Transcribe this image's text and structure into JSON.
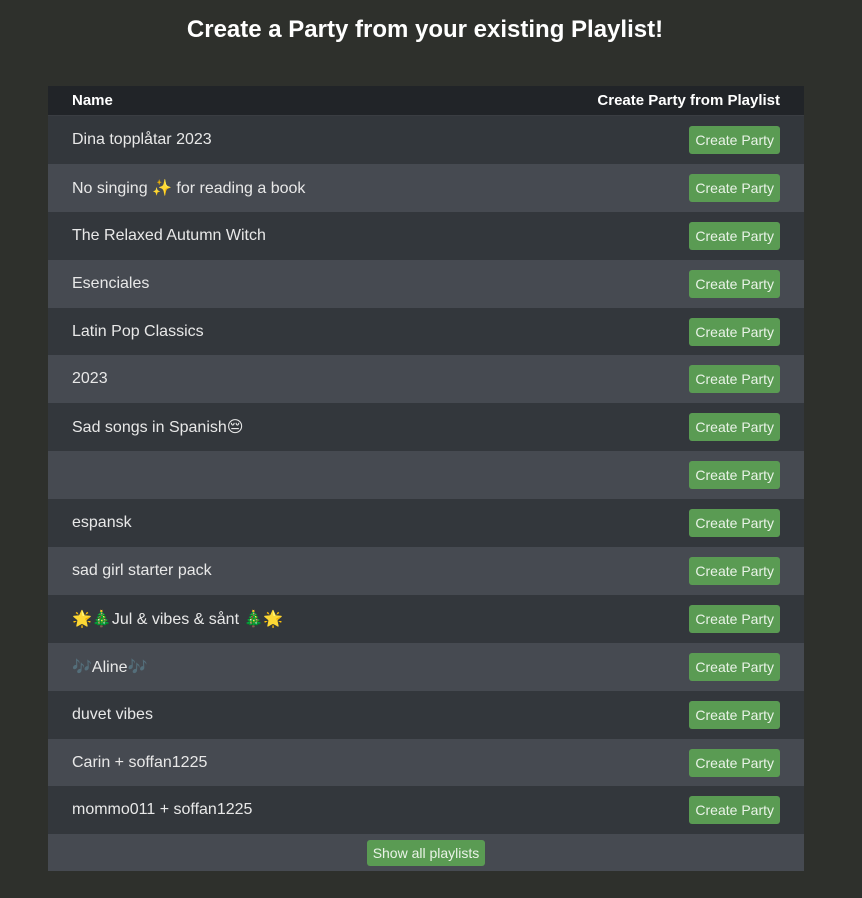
{
  "page": {
    "title": "Create a Party from your existing Playlist!"
  },
  "table": {
    "headers": {
      "name": "Name",
      "action": "Create Party from Playlist"
    },
    "rows": [
      {
        "name": "Dina topplåtar 2023",
        "button": "Create Party"
      },
      {
        "name": "No singing ✨ for reading a book",
        "button": "Create Party"
      },
      {
        "name": "The Relaxed Autumn Witch",
        "button": "Create Party"
      },
      {
        "name": "Esenciales",
        "button": "Create Party"
      },
      {
        "name": "Latin Pop Classics",
        "button": "Create Party"
      },
      {
        "name": "2023",
        "button": "Create Party"
      },
      {
        "name": "Sad songs in Spanish😔",
        "button": "Create Party"
      },
      {
        "name": "",
        "button": "Create Party"
      },
      {
        "name": "espansk",
        "button": "Create Party"
      },
      {
        "name": "sad girl starter pack",
        "button": "Create Party"
      },
      {
        "name": "🌟🎄Jul & vibes & sånt 🎄🌟",
        "button": "Create Party"
      },
      {
        "name": "🎶Aline🎶",
        "button": "Create Party"
      },
      {
        "name": "duvet vibes",
        "button": "Create Party"
      },
      {
        "name": "Carin + soffan1225",
        "button": "Create Party"
      },
      {
        "name": "mommo011 + soffan1225",
        "button": "Create Party"
      }
    ],
    "show_all_label": "Show all playlists"
  },
  "colors": {
    "background": "#2e302c",
    "header_bg": "#212428",
    "row_dark": "#33373c",
    "row_light": "#464a51",
    "button_green": "#5a9b53"
  }
}
